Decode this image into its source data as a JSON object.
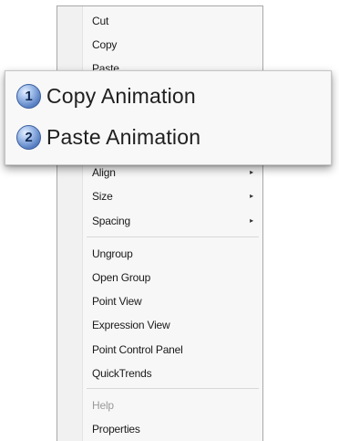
{
  "context_menu": {
    "items_top": [
      "Cut",
      "Copy",
      "Paste"
    ],
    "items_mid": [
      {
        "label": "Align",
        "has_submenu": true
      },
      {
        "label": "Size",
        "has_submenu": true
      },
      {
        "label": "Spacing",
        "has_submenu": true
      }
    ],
    "items_group": [
      "Ungroup",
      "Open Group",
      "Point View",
      "Expression View",
      "Point Control Panel",
      "QuickTrends"
    ],
    "help_label": "Help",
    "help_disabled": true,
    "properties_label": "Properties",
    "submenu_arrow": "▸"
  },
  "callout": {
    "items": [
      {
        "number": "1",
        "label": "Copy Animation"
      },
      {
        "number": "2",
        "label": "Paste Animation"
      }
    ]
  },
  "colors": {
    "badge_fill": "#5b82c4",
    "menu_background": "#f7f7f7",
    "disabled_text": "#9a9a9a"
  }
}
